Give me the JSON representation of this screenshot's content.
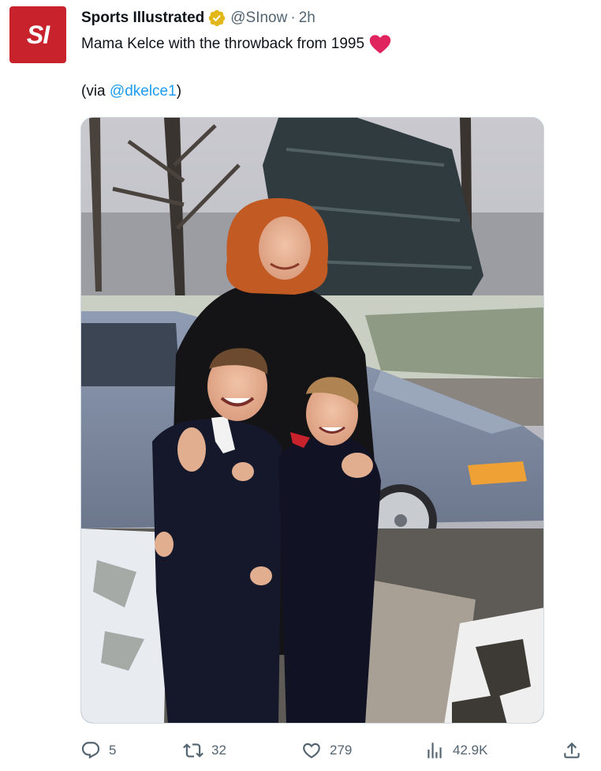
{
  "author": {
    "avatar_text": "SI",
    "name": "Sports Illustrated",
    "handle": "@SInow",
    "separator": "·",
    "time": "2h",
    "verified_icon": "verified-badge-gold",
    "brand_color": "#c8232c"
  },
  "tweet": {
    "text": "Mama Kelce with the throwback from 1995",
    "emoji": "heart",
    "via_prefix": "(via ",
    "via_mention": "@dkelce1",
    "via_suffix": ")",
    "mention_color": "#1d9bf0"
  },
  "actions": {
    "reply_count": "5",
    "retweet_count": "32",
    "like_count": "279",
    "views_count": "42.9K",
    "icons": [
      "reply-icon",
      "retweet-icon",
      "like-icon",
      "views-icon",
      "share-icon"
    ]
  }
}
